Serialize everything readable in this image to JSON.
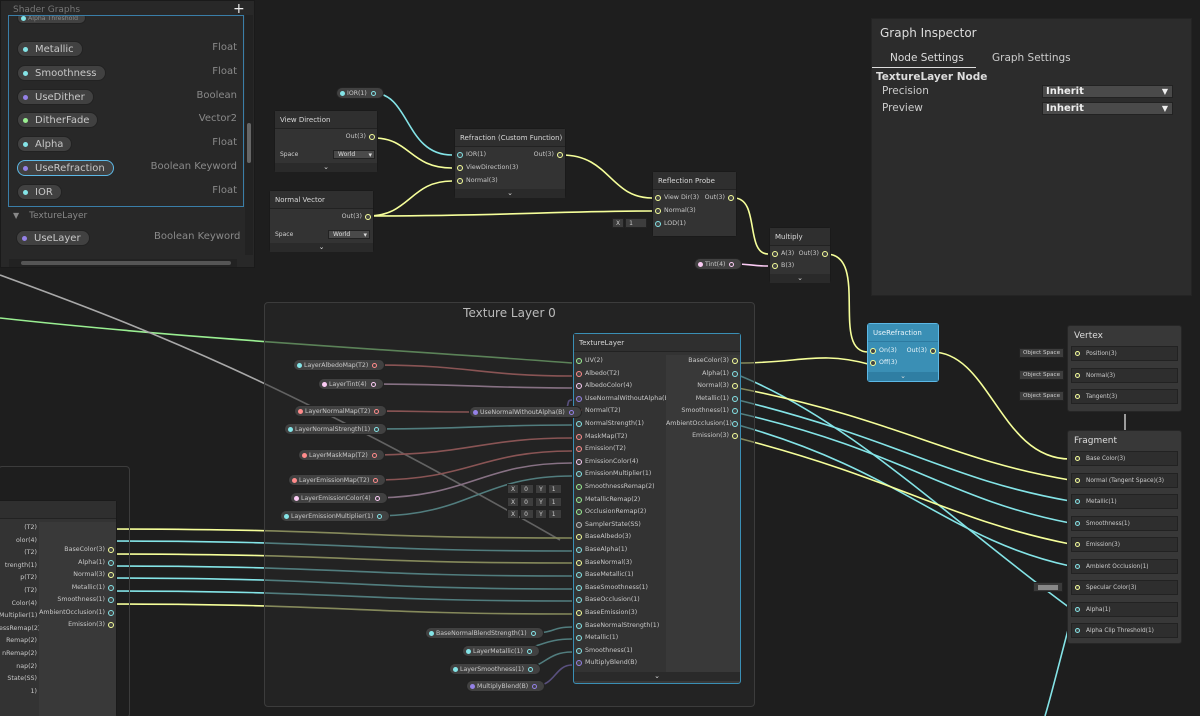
{
  "blackboard": {
    "title": "Shader Graphs",
    "add_icon": "plus-icon",
    "truncated_top_item": "Alpha Threshold",
    "properties": [
      {
        "name": "Metallic",
        "type": "Float"
      },
      {
        "name": "Smoothness",
        "type": "Float"
      },
      {
        "name": "UseDither",
        "type": "Boolean"
      },
      {
        "name": "DitherFade",
        "type": "Vector2"
      },
      {
        "name": "Alpha",
        "type": "Float"
      },
      {
        "name": "UseRefraction",
        "type": "Boolean Keyword"
      },
      {
        "name": "IOR",
        "type": "Float"
      }
    ],
    "category": "TextureLayer",
    "category_items": [
      {
        "name": "UseLayer",
        "type": "Boolean Keyword"
      }
    ]
  },
  "inspector": {
    "title": "Graph Inspector",
    "tabs": [
      "Node Settings",
      "Graph Settings"
    ],
    "node_title": "TextureLayer Node",
    "fields": [
      {
        "label": "Precision",
        "value": "Inherit"
      },
      {
        "label": "Preview",
        "value": "Inherit"
      }
    ]
  },
  "nodes": {
    "ior": "IOR(1)",
    "view_direction": {
      "title": "View Direction",
      "out": "Out(3)",
      "space_label": "Space",
      "space_value": "World"
    },
    "normal_vector": {
      "title": "Normal Vector",
      "out": "Out(3)",
      "space_label": "Space",
      "space_value": "World"
    },
    "refraction": {
      "title": "Refraction (Custom Function)",
      "inputs": [
        "IOR(1)",
        "ViewDirection(3)",
        "Normal(3)"
      ],
      "out": "Out(3)"
    },
    "reflection_probe": {
      "title": "Reflection Probe",
      "inputs": [
        "View Dir(3)",
        "Normal(3)",
        "LOD(1)"
      ],
      "out": "Out(3)",
      "lod_x_label": "X",
      "lod_x_value": "1"
    },
    "multiply": {
      "title": "Multiply",
      "inputs": [
        "A(3)",
        "B(3)"
      ],
      "out": "Out(3)"
    },
    "tint": "Tint(4)",
    "use_refraction": {
      "title": "UseRefraction",
      "inputs": [
        "On(3)",
        "Off(3)"
      ],
      "out": "Out(3)"
    },
    "chevron": "⌄"
  },
  "group": {
    "title": "Texture Layer 0"
  },
  "texture_layer": {
    "title": "TextureLayer",
    "inputs": [
      "UV(2)",
      "Albedo(T2)",
      "AlbedoColor(4)",
      "UseNormalWithoutAlpha(B)",
      "Normal(T2)",
      "NormalStrength(1)",
      "MaskMap(T2)",
      "Emission(T2)",
      "EmissionColor(4)",
      "EmissionMultiplier(1)",
      "SmoothnessRemap(2)",
      "MetallicRemap(2)",
      "OcclusionRemap(2)",
      "SamplerState(SS)",
      "BaseAlbedo(3)",
      "BaseAlpha(1)",
      "BaseNormal(3)",
      "BaseMetallic(1)",
      "BaseSmoothness(1)",
      "BaseOcclusion(1)",
      "BaseEmission(3)",
      "BaseNormalStrength(1)",
      "Metallic(1)",
      "Smoothness(1)",
      "MultiplyBlend(B)"
    ],
    "outputs": [
      "BaseColor(3)",
      "Alpha(1)",
      "Normal(3)",
      "Metallic(1)",
      "Smoothness(1)",
      "AmbientOcclusion(1)",
      "Emission(3)"
    ],
    "remap_rows": [
      {
        "x_label": "X",
        "x_value": "0",
        "y_label": "Y",
        "y_value": "1"
      },
      {
        "x_label": "X",
        "x_value": "0",
        "y_label": "Y",
        "y_value": "1"
      },
      {
        "x_label": "X",
        "x_value": "0",
        "y_label": "Y",
        "y_value": "1"
      }
    ]
  },
  "layer_props": [
    "LayerAlbedoMap(T2)",
    "LayerTint(4)",
    "LayerNormalMap(T2)",
    "UseNormalWithoutAlpha(B)",
    "LayerNormalStrength(1)",
    "LayerMaskMap(T2)",
    "LayerEmissionMap(T2)",
    "LayerEmissionColor(4)",
    "LayerEmissionMultiplier(1)",
    "BaseNormalBlendStrength(1)",
    "LayerMetallic(1)",
    "LayerSmoothness(1)",
    "MultiplyBlend(B)"
  ],
  "left_node": {
    "outputs": [
      "BaseColor(3)",
      "Alpha(1)",
      "Normal(3)",
      "Metallic(1)",
      "Smoothness(1)",
      "AmbientOcclusion(1)",
      "Emission(3)"
    ],
    "clipped_inputs": [
      "(T2)",
      "olor(4)",
      "(T2)",
      "trength(1)",
      "p(T2)",
      "(T2)",
      "Color(4)",
      "Multiplier(1)",
      "essRemap(2)",
      "Remap(2)",
      "nRemap(2)",
      "nap(2)",
      "State(SS)",
      "1)"
    ]
  },
  "vertex": {
    "title": "Vertex",
    "rows": [
      "Position(3)",
      "Normal(3)",
      "Tangent(3)"
    ],
    "space": "Object Space"
  },
  "fragment": {
    "title": "Fragment",
    "rows": [
      "Base Color(3)",
      "Normal (Tangent Space)(3)",
      "Metallic(1)",
      "Smoothness(1)",
      "Emission(3)",
      "Ambient Occlusion(1)",
      "Specular Color(3)",
      "Alpha(1)",
      "Alpha Clip Threshold(1)"
    ]
  },
  "colors": {
    "float": "#84e4e7",
    "vector2": "#9aef92",
    "vector3": "#f6ff9a",
    "vector4": "#fbcbf4",
    "texture": "#ff8b8b",
    "boolean": "#9481e6",
    "selected": "#3a8fb5"
  }
}
